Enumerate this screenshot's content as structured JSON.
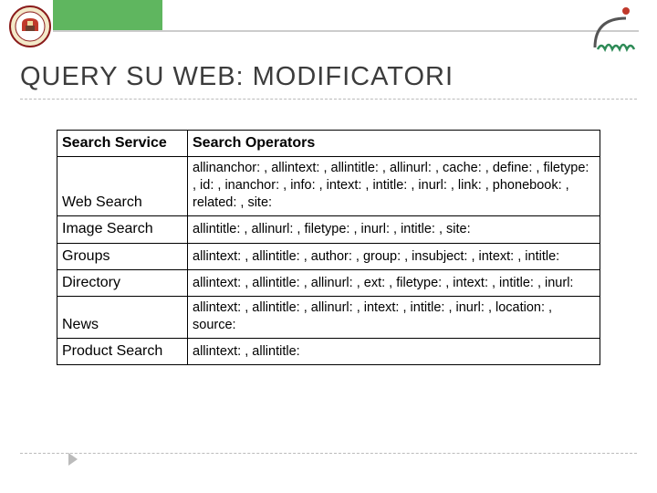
{
  "title": "QUERY SU WEB: MODIFICATORI",
  "columns": {
    "service": "Search Service",
    "operators": "Search Operators"
  },
  "rows": [
    {
      "service": "Web Search",
      "operators": "allinanchor: , allintext: , allintitle: , allinurl: , cache: , define: , filetype: , id: , inanchor: , info: , intext: , intitle: , inurl: , link: , phonebook: , related: , site:"
    },
    {
      "service": "Image Search",
      "operators": "allintitle: , allinurl: , filetype: , inurl: , intitle: , site:"
    },
    {
      "service": "Groups",
      "operators": "allintext: , allintitle: , author: , group: , insubject: , intext: , intitle:"
    },
    {
      "service": "Directory",
      "operators": "allintext: , allintitle: , allinurl: , ext: , filetype: , intext: , intitle: , inurl:"
    },
    {
      "service": "News",
      "operators": "allintext: , allintitle: , allinurl: , intext: , intitle: , inurl: , location: , source:"
    },
    {
      "service": "Product Search",
      "operators": "allintext: , allintitle:"
    }
  ]
}
